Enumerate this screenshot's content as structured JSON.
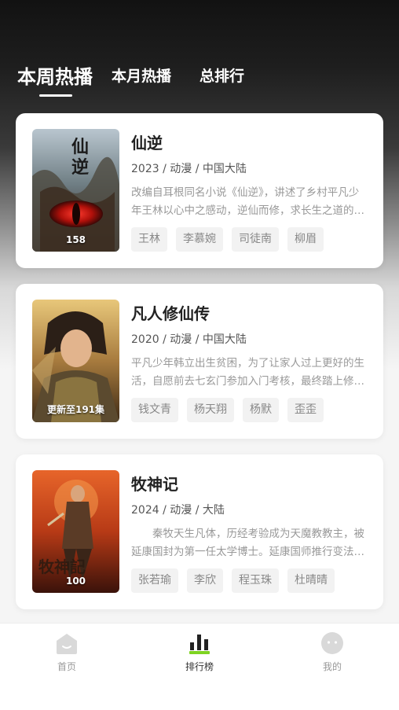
{
  "tabs": {
    "weekly": "本周热播",
    "monthly": "本月热播",
    "overall": "总排行"
  },
  "items": [
    {
      "title": "仙逆",
      "meta": "2023 / 动漫 / 中国大陆",
      "desc": "改编自耳根同名小说《仙逆》，讲述了乡村平凡少年王林以心中之感动，逆仙而修，求长生之道的故事。",
      "badge": "158",
      "tags": [
        "王林",
        "李慕婉",
        "司徒南",
        "柳眉"
      ]
    },
    {
      "title": "凡人修仙传",
      "meta": "2020 / 动漫 / 中国大陆",
      "desc": "平凡少年韩立出生贫困，为了让家人过上更好的生活，自愿前去七玄门参加入门考核，最终踏上修仙之路。",
      "badge": "更新至191集",
      "tags": [
        "钱文青",
        "杨天翔",
        "杨默",
        "歪歪"
      ]
    },
    {
      "title": "牧神记",
      "meta": "2024 / 动漫 / 大陆",
      "desc": "　　秦牧天生凡体，历经考验成为天魔教教主，被延康国封为第一任太学博士。延康国师推行变法的故事。",
      "badge": "100",
      "tags": [
        "张若瑜",
        "李欣",
        "程玉珠",
        "杜晴晴"
      ]
    }
  ],
  "nav": {
    "home": "首页",
    "rank": "排行榜",
    "me": "我的"
  },
  "colors": {
    "accent": "#7ed321",
    "text_primary": "#222222",
    "text_secondary": "#999999"
  }
}
